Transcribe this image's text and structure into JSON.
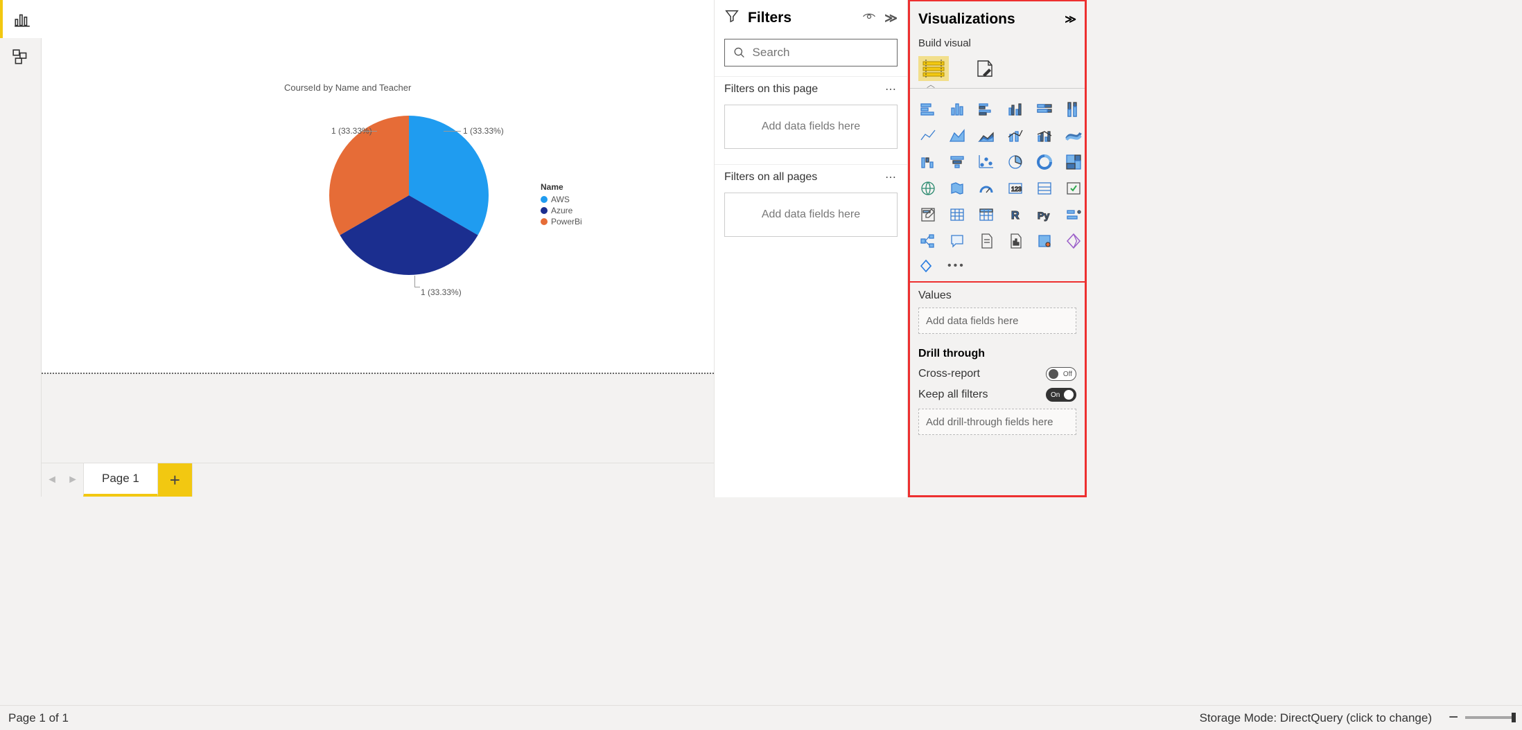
{
  "leftnav": {
    "items": [
      {
        "name": "report-view-icon",
        "active": true
      },
      {
        "name": "model-view-icon",
        "active": false
      }
    ]
  },
  "chart_data": {
    "type": "pie",
    "title": "CourseId by Name and Teacher",
    "legend_title": "Name",
    "series": [
      {
        "name": "AWS",
        "value": 1,
        "pct": 33.33,
        "color": "#1f9cf0",
        "label": "1 (33.33%)"
      },
      {
        "name": "Azure",
        "value": 1,
        "pct": 33.33,
        "color": "#1b2e8f",
        "label": "1 (33.33%)"
      },
      {
        "name": "PowerBi",
        "value": 1,
        "pct": 33.33,
        "color": "#e66c37",
        "label": "1 (33.33%)"
      }
    ]
  },
  "tabs": {
    "page1": "Page 1"
  },
  "statusbar": {
    "page_indicator": "Page 1 of 1",
    "storage_mode": "Storage Mode: DirectQuery (click to change)"
  },
  "filters": {
    "title": "Filters",
    "search_placeholder": "Search",
    "on_this_page": "Filters on this page",
    "on_all_pages": "Filters on all pages",
    "add_fields": "Add data fields here"
  },
  "viz": {
    "title": "Visualizations",
    "subtitle": "Build visual",
    "values_label": "Values",
    "add_fields": "Add data fields here",
    "drill_heading": "Drill through",
    "cross_report": "Cross-report",
    "cross_report_state": "Off",
    "keep_filters": "Keep all filters",
    "keep_filters_state": "On",
    "add_drill_fields": "Add drill-through fields here",
    "icons": [
      "stacked-bar",
      "stacked-column",
      "clustered-bar",
      "clustered-column",
      "100-stacked-bar",
      "100-stacked-column",
      "line",
      "area",
      "stacked-area",
      "line-stacked-column",
      "line-clustered-column",
      "ribbon",
      "waterfall",
      "funnel",
      "scatter",
      "pie",
      "donut",
      "treemap",
      "map",
      "filled-map",
      "gauge",
      "card",
      "multi-row-card",
      "kpi",
      "slicer",
      "table",
      "matrix",
      "r-visual",
      "py-visual",
      "key-influencers",
      "decomposition-tree",
      "qa",
      "narrative",
      "paginated",
      "powerapps",
      "powerautomate"
    ]
  }
}
